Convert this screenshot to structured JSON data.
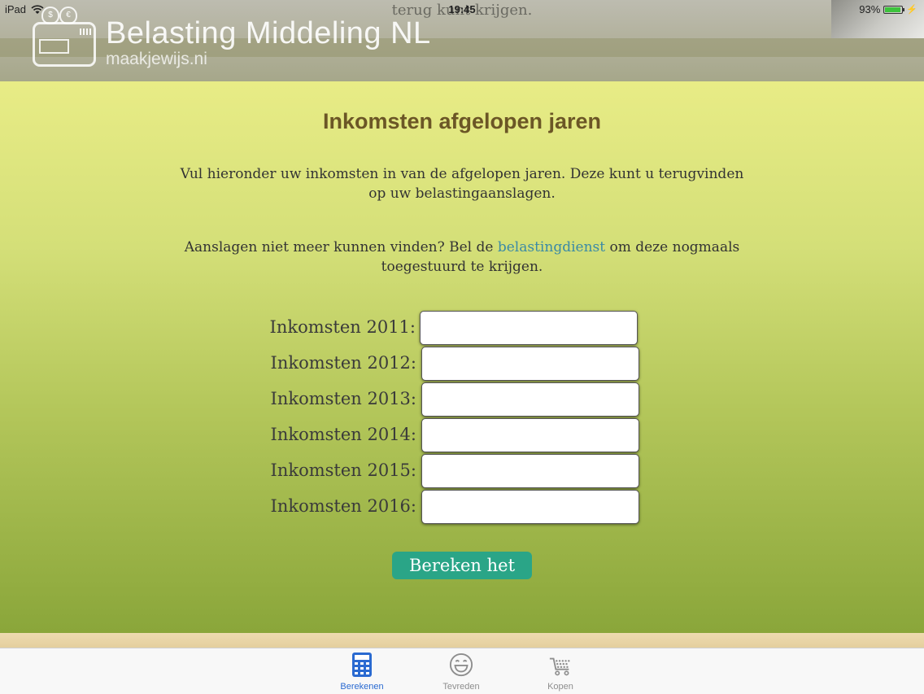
{
  "status_bar": {
    "device": "iPad",
    "time": "19:45",
    "battery": "93%",
    "battery_level": 0.93
  },
  "header": {
    "overlap_text": "terug kunt krijgen.",
    "title": "Belasting Middeling NL",
    "subtitle": "maakjewijs.ni"
  },
  "main": {
    "heading": "Inkomsten afgelopen jaren",
    "intro": "Vul hieronder uw inkomsten in van de afgelopen jaren. Deze kunt u terugvinden op uw belastingaanslagen.",
    "help_before": "Aanslagen niet meer kunnen vinden? Bel de ",
    "help_link": "belastingdienst",
    "help_after": " om deze nogmaals toegestuurd te krijgen.",
    "fields": [
      {
        "label": "Inkomsten 2011:",
        "value": ""
      },
      {
        "label": "Inkomsten 2012:",
        "value": ""
      },
      {
        "label": "Inkomsten 2013:",
        "value": ""
      },
      {
        "label": "Inkomsten 2014:",
        "value": ""
      },
      {
        "label": "Inkomsten 2015:",
        "value": ""
      },
      {
        "label": "Inkomsten 2016:",
        "value": ""
      }
    ],
    "submit_label": "Bereken het"
  },
  "tabbar": {
    "tabs": [
      {
        "label": "Berekenen",
        "icon": "calculator-icon",
        "active": true
      },
      {
        "label": "Tevreden",
        "icon": "smiley-icon",
        "active": false
      },
      {
        "label": "Kopen",
        "icon": "cart-icon",
        "active": false
      }
    ]
  },
  "colors": {
    "accent": "#2aa587",
    "heading": "#6b5626",
    "link": "#3a8aa6",
    "tab_active": "#2a6ad1"
  }
}
